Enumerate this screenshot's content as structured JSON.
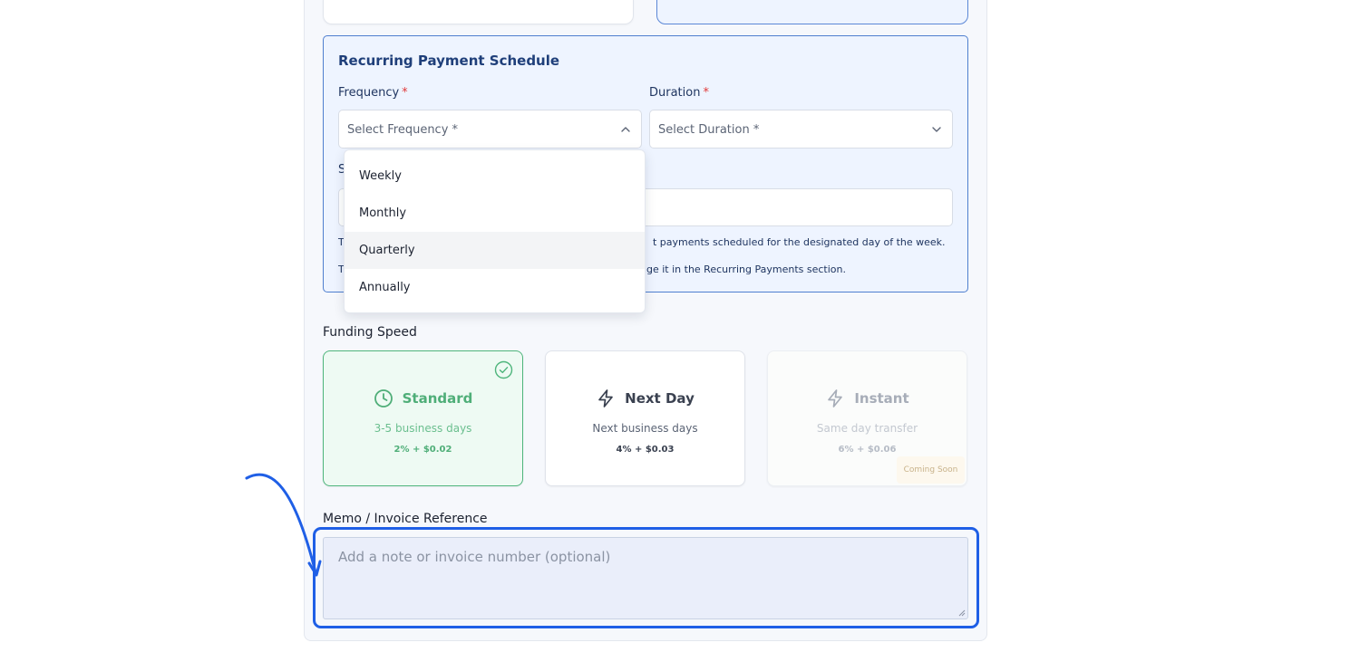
{
  "recurring": {
    "title": "Recurring Payment Schedule",
    "frequency": {
      "label": "Frequency",
      "required": "*",
      "placeholder": "Select Frequency *"
    },
    "duration": {
      "label": "Duration",
      "required": "*",
      "placeholder": "Select Duration *"
    },
    "hidden_label_fragment": "S",
    "note1_left": "T",
    "note1_right": "t payments scheduled for the designated day of the week.",
    "note2_left": "T",
    "note2_right": "ge it in the Recurring Payments section.",
    "frequency_options": [
      "Weekly",
      "Monthly",
      "Quarterly",
      "Annually"
    ]
  },
  "funding_speed": {
    "label": "Funding Speed",
    "options": [
      {
        "title": "Standard",
        "subtitle": "3-5 business days",
        "fee": "2% + $0.02",
        "icon": "clock-icon"
      },
      {
        "title": "Next Day",
        "subtitle": "Next business days",
        "fee": "4% + $0.03",
        "icon": "lightning-icon"
      },
      {
        "title": "Instant",
        "subtitle": "Same day transfer",
        "fee": "6% + $0.06",
        "icon": "lightning-icon",
        "badge": "Coming Soon"
      }
    ],
    "selected": "Standard"
  },
  "memo": {
    "label": "Memo / Invoice Reference",
    "placeholder": "Add a note or invoice number (optional)"
  },
  "colors": {
    "accent_blue": "#1f5fe6",
    "selected_green": "#4fb57c",
    "title_blue": "#1f3f7a",
    "required_red": "#e03a3a"
  }
}
